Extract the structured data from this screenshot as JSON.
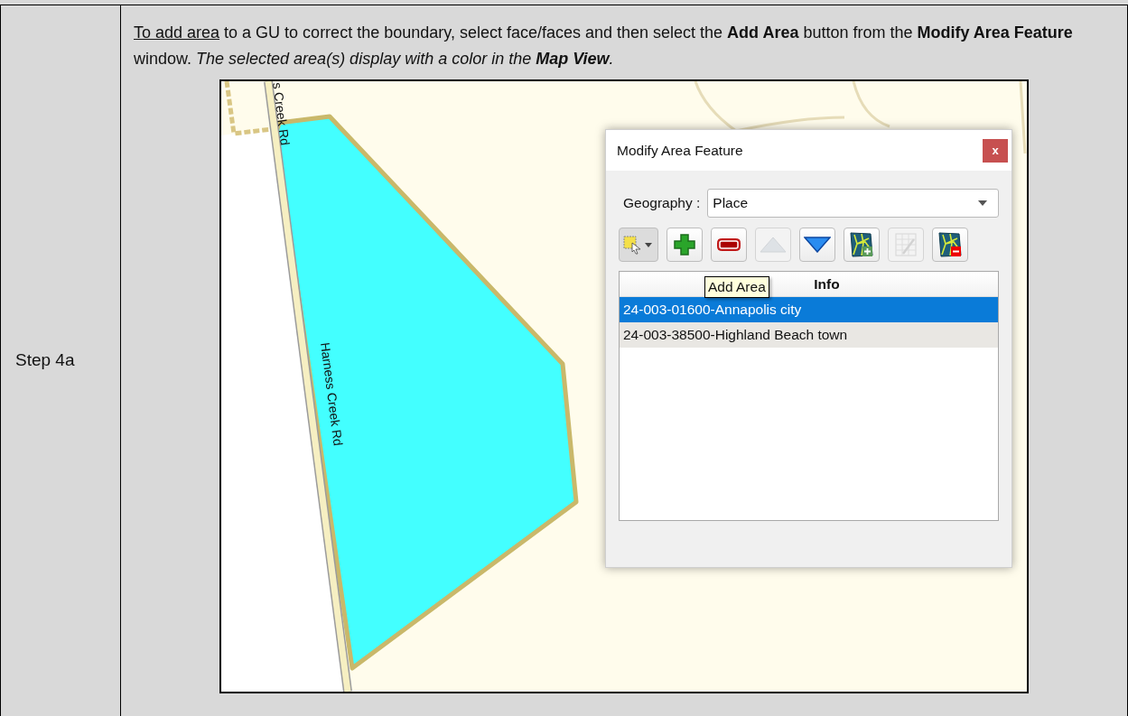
{
  "document": {
    "step_label": "Step 4a",
    "instruction": {
      "underlined_lead": "To add area",
      "text": " to a GU to correct the boundary, select face/faces and then select the **Add Area** button from the **Modify Area Feature** window. ",
      "italic_text": "The selected area(s) display with a color in the **Map View**."
    }
  },
  "map": {
    "road_labels": [
      {
        "text": "s Creek Rd"
      },
      {
        "text": "Harness Creek Rd"
      }
    ]
  },
  "dialog": {
    "title": "Modify Area Feature",
    "close": "x",
    "geography_label": "Geography :",
    "geography_value": "Place",
    "toolbar": [
      {
        "kind": "select",
        "disabled": false
      },
      {
        "kind": "add",
        "disabled": false
      },
      {
        "kind": "remove",
        "disabled": false
      },
      {
        "kind": "up",
        "disabled": true
      },
      {
        "kind": "down",
        "disabled": false
      },
      {
        "kind": "map-add",
        "disabled": false
      },
      {
        "kind": "table-edit",
        "disabled": true
      },
      {
        "kind": "map-remove",
        "disabled": false
      }
    ],
    "tooltip": {
      "text": "Add Area"
    },
    "list": {
      "header": "Info",
      "rows": [
        {
          "text": "24-003-01600-Annapolis city",
          "selected": true
        },
        {
          "text": "24-003-38500-Highland Beach town",
          "selected": false
        }
      ]
    }
  }
}
